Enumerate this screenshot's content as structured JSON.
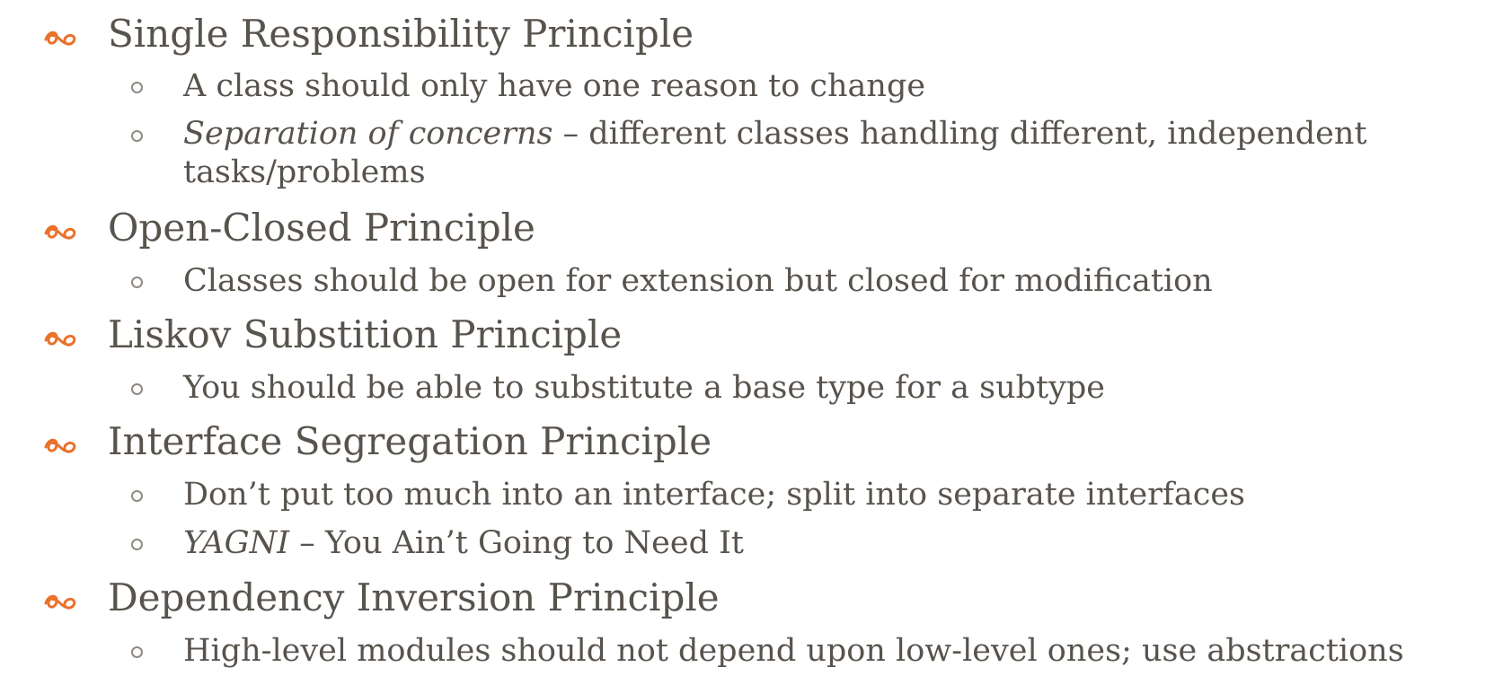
{
  "colors": {
    "accent": "#e9712a",
    "text": "#58534d",
    "sub_bullet": "#8f8a84"
  },
  "icons": {
    "main_bullet": "scroll-flourish-icon",
    "sub_bullet": "hollow-circle-icon"
  },
  "principles": [
    {
      "title": "Single Responsibility Principle",
      "points": [
        {
          "emphasis": "",
          "text": "A class should only have one reason to change"
        },
        {
          "emphasis": "Separation of concerns",
          "text": " – different classes handling different, independent tasks/problems"
        }
      ]
    },
    {
      "title": "Open-Closed Principle",
      "points": [
        {
          "emphasis": "",
          "text": "Classes should be open for extension but closed for modification"
        }
      ]
    },
    {
      "title": "Liskov Substition Principle",
      "points": [
        {
          "emphasis": "",
          "text": "You should be able to substitute a base type for a subtype"
        }
      ]
    },
    {
      "title": "Interface Segregation Principle",
      "points": [
        {
          "emphasis": "",
          "text": "Don’t put too much into an interface; split into separate interfaces"
        },
        {
          "emphasis": "YAGNI",
          "text": " – You Ain’t Going to Need It"
        }
      ]
    },
    {
      "title": "Dependency Inversion Principle",
      "points": [
        {
          "emphasis": "",
          "text": "High-level modules should not depend upon low-level ones; use abstractions"
        }
      ]
    }
  ]
}
